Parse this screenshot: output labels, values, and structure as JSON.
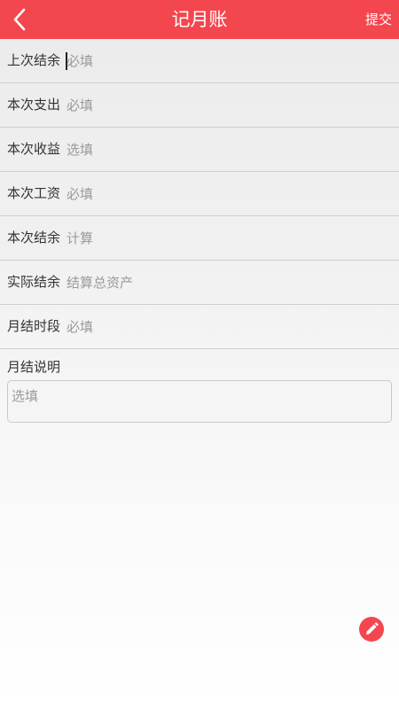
{
  "header": {
    "title": "记月账",
    "submit_label": "提交",
    "back_icon": "chevron-left-icon",
    "color": "#f4464e"
  },
  "form": {
    "rows": [
      {
        "label": "上次结余",
        "placeholder": "必填"
      },
      {
        "label": "本次支出",
        "placeholder": "必填"
      },
      {
        "label": "本次收益",
        "placeholder": "选填"
      },
      {
        "label": "本次工资",
        "placeholder": "必填"
      },
      {
        "label": "本次结余",
        "placeholder": "计算"
      },
      {
        "label": "实际结余",
        "placeholder": "结算总资产"
      },
      {
        "label": "月结时段",
        "placeholder": "必填"
      }
    ],
    "note": {
      "label": "月结说明",
      "placeholder": "选填"
    }
  },
  "fab": {
    "icon": "pencil-icon",
    "color": "#f4464e"
  }
}
